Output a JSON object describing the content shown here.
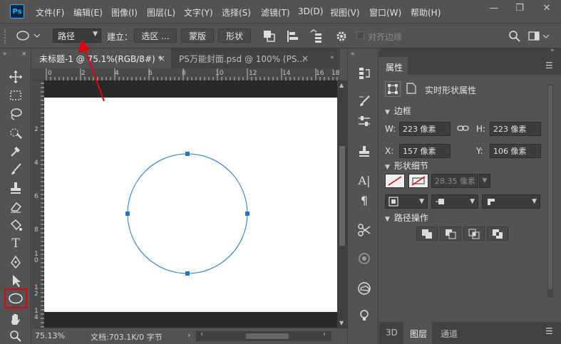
{
  "app": {
    "logo": "Ps"
  },
  "menu": [
    "文件(F)",
    "编辑(E)",
    "图像(I)",
    "图层(L)",
    "文字(Y)",
    "选择(S)",
    "滤镜(T)",
    "3D(D)",
    "视图(V)",
    "窗口(W)",
    "帮助(H)"
  ],
  "window_controls": {
    "minimize": "—",
    "restore": "❐",
    "close": "✕"
  },
  "options": {
    "mode_value": "路径",
    "build_label": "建立：",
    "selection_btn": "选区 ...",
    "mask_btn": "蒙版",
    "shape_btn": "形状",
    "align_edges": "对齐边缘"
  },
  "tabs": [
    {
      "label": "未标题-1 @ 75.1%(RGB/8#) *",
      "close": "×"
    },
    {
      "label": "PS万能封面.psd @ 100% (PS...",
      "close": "×"
    }
  ],
  "ruler": {
    "h": [
      "0",
      "2",
      "4",
      "6",
      "8",
      "10",
      "12",
      "14",
      "16",
      "18"
    ],
    "v": [
      "2",
      "4",
      "6",
      "8",
      "1\n0",
      "1\n2",
      "1\n4",
      "1\n6"
    ]
  },
  "status": {
    "zoom": "75.13%",
    "doc": "文档:703.1K/0 字节"
  },
  "properties": {
    "tab": "属性",
    "shape_title": "实时形状属性",
    "border_section": "边框",
    "w_label": "W:",
    "w_value": "223 像素",
    "h_label": "H:",
    "h_value": "223 像素",
    "x_label": "X:",
    "x_value": "157 像素",
    "y_label": "Y:",
    "y_value": "106 像素",
    "detail_section": "形状细节",
    "stroke_value": "28.35 像素",
    "path_ops_section": "路径操作"
  },
  "bottom_tabs": {
    "tab3d": "3D",
    "layers": "图层",
    "channels": "通道"
  },
  "colors": {
    "accent_red": "#e0000f",
    "path_blue": "#1e78c8",
    "ui_dark": "#535353"
  }
}
